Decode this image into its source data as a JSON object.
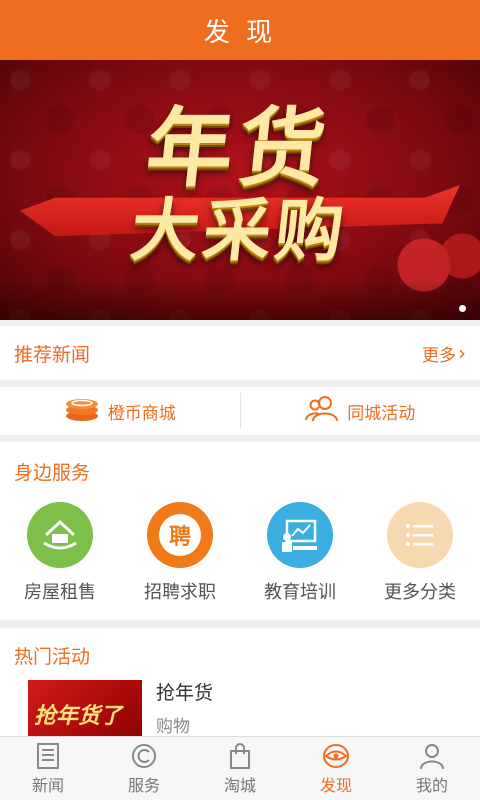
{
  "header": {
    "title": "发 现"
  },
  "banner": {
    "line1": "年货",
    "line2": "大采购"
  },
  "recommend": {
    "title": "推荐新闻",
    "more": "更多",
    "more_arrow": "›"
  },
  "quick": [
    {
      "label": "橙币商城",
      "icon": "coins-icon"
    },
    {
      "label": "同城活动",
      "icon": "people-icon"
    }
  ],
  "services": {
    "title": "身边服务",
    "items": [
      {
        "label": "房屋租售",
        "icon": "house-icon",
        "color": "#7cc04a"
      },
      {
        "label": "招聘求职",
        "icon": "recruit-icon",
        "color": "#f07a17",
        "glyph": "聘"
      },
      {
        "label": "教育培训",
        "icon": "teacher-icon",
        "color": "#3aaee0"
      },
      {
        "label": "更多分类",
        "icon": "list-icon",
        "color": "#f6d9b0"
      }
    ]
  },
  "hot": {
    "title": "热门活动",
    "item": {
      "name": "抢年货",
      "category": "购物",
      "thumb_text": "抢年货了"
    }
  },
  "tabs": [
    {
      "label": "新闻",
      "icon": "news-icon",
      "active": false
    },
    {
      "label": "服务",
      "icon": "service-icon",
      "active": false
    },
    {
      "label": "淘城",
      "icon": "bag-icon",
      "active": false
    },
    {
      "label": "发现",
      "icon": "eye-icon",
      "active": true
    },
    {
      "label": "我的",
      "icon": "user-icon",
      "active": false
    }
  ],
  "colors": {
    "accent": "#ef6d1e"
  }
}
